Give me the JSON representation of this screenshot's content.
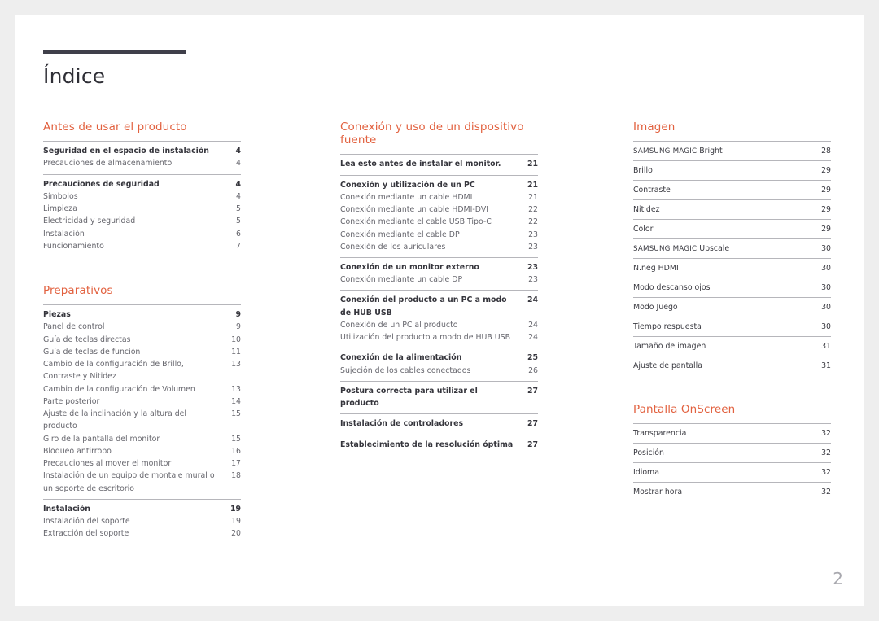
{
  "document": {
    "title": "Índice",
    "page_number": "2"
  },
  "colors": {
    "heading_accent": "#e2613f",
    "title_rule": "#3f3f4a",
    "rule": "#b6b6bb",
    "page_number": "#a8a8ae",
    "page_background": "#ffffff",
    "canvas_background": "#eeeeee"
  },
  "columns": [
    {
      "id": "left",
      "sections": [
        {
          "heading": "Antes de usar el producto",
          "groups": [
            {
              "entries": [
                {
                  "label": "Seguridad en el espacio de instalación",
                  "page": "4",
                  "level": 1
                },
                {
                  "label": "Precauciones de almacenamiento",
                  "page": "4",
                  "level": 2
                }
              ]
            },
            {
              "entries": [
                {
                  "label": "Precauciones de seguridad",
                  "page": "4",
                  "level": 1
                },
                {
                  "label": "Símbolos",
                  "page": "4",
                  "level": 2
                },
                {
                  "label": "Limpieza",
                  "page": "5",
                  "level": 2
                },
                {
                  "label": "Electricidad y seguridad",
                  "page": "5",
                  "level": 2
                },
                {
                  "label": "Instalación",
                  "page": "6",
                  "level": 2
                },
                {
                  "label": "Funcionamiento",
                  "page": "7",
                  "level": 2
                }
              ]
            }
          ]
        },
        {
          "heading": "Preparativos",
          "groups": [
            {
              "entries": [
                {
                  "label": "Piezas",
                  "page": "9",
                  "level": 1
                },
                {
                  "label": "Panel de control",
                  "page": "9",
                  "level": 2
                },
                {
                  "label": "Guía de teclas directas",
                  "page": "10",
                  "level": 2
                },
                {
                  "label": "Guía de teclas de función",
                  "page": "11",
                  "level": 2
                },
                {
                  "label": "Cambio de la configuración de Brillo, Contraste y Nitidez",
                  "page": "13",
                  "level": 2
                },
                {
                  "label": "Cambio de la configuración de Volumen",
                  "page": "13",
                  "level": 2
                },
                {
                  "label": "Parte posterior",
                  "page": "14",
                  "level": 2
                },
                {
                  "label": "Ajuste de la inclinación y la altura del producto",
                  "page": "15",
                  "level": 2
                },
                {
                  "label": "Giro de la pantalla del monitor",
                  "page": "15",
                  "level": 2
                },
                {
                  "label": "Bloqueo antirrobo",
                  "page": "16",
                  "level": 2
                },
                {
                  "label": "Precauciones al mover el monitor",
                  "page": "17",
                  "level": 2
                },
                {
                  "label": "Instalación de un equipo de montaje mural o un soporte de escritorio",
                  "page": "18",
                  "level": 2
                }
              ]
            },
            {
              "entries": [
                {
                  "label": "Instalación",
                  "page": "19",
                  "level": 1
                },
                {
                  "label": "Instalación del soporte",
                  "page": "19",
                  "level": 2
                },
                {
                  "label": "Extracción del soporte",
                  "page": "20",
                  "level": 2
                }
              ]
            }
          ]
        }
      ]
    },
    {
      "id": "middle",
      "sections": [
        {
          "heading": "Conexión y uso de un dispositivo fuente",
          "groups": [
            {
              "entries": [
                {
                  "label": "Lea esto antes de instalar el monitor.",
                  "page": "21",
                  "level": 1
                }
              ]
            },
            {
              "entries": [
                {
                  "label": "Conexión y utilización de un PC",
                  "page": "21",
                  "level": 1
                },
                {
                  "label": "Conexión mediante un cable HDMI",
                  "page": "21",
                  "level": 2
                },
                {
                  "label": "Conexión mediante un cable HDMI-DVI",
                  "page": "22",
                  "level": 2
                },
                {
                  "label": "Conexión mediante el cable USB Tipo-C",
                  "page": "22",
                  "level": 2
                },
                {
                  "label": "Conexión mediante el cable DP",
                  "page": "23",
                  "level": 2
                },
                {
                  "label": "Conexión de los auriculares",
                  "page": "23",
                  "level": 2
                }
              ]
            },
            {
              "entries": [
                {
                  "label": "Conexión de un monitor externo",
                  "page": "23",
                  "level": 1
                },
                {
                  "label": "Conexión mediante un cable DP",
                  "page": "23",
                  "level": 2
                }
              ]
            },
            {
              "entries": [
                {
                  "label": "Conexión del producto a un PC a modo de HUB USB",
                  "page": "24",
                  "level": 1
                },
                {
                  "label": "Conexión de un PC al producto",
                  "page": "24",
                  "level": 2
                },
                {
                  "label": "Utilización del producto a modo de HUB USB",
                  "page": "24",
                  "level": 2
                }
              ]
            },
            {
              "entries": [
                {
                  "label": "Conexión de la alimentación",
                  "page": "25",
                  "level": 1
                },
                {
                  "label": "Sujeción de los cables conectados",
                  "page": "26",
                  "level": 2
                }
              ]
            },
            {
              "entries": [
                {
                  "label": "Postura correcta para utilizar el producto",
                  "page": "27",
                  "level": 1
                }
              ]
            },
            {
              "entries": [
                {
                  "label": "Instalación de controladores",
                  "page": "27",
                  "level": 1
                }
              ]
            },
            {
              "entries": [
                {
                  "label": "Establecimiento de la resolución óptima",
                  "page": "27",
                  "level": 1
                }
              ]
            }
          ]
        }
      ]
    },
    {
      "id": "right",
      "sections": [
        {
          "heading": "Imagen",
          "rows": [
            {
              "label": "SAMSUNG MAGIC Bright",
              "page": "28",
              "smallcaps_prefix": "SAMSUNG MAGIC",
              "smallcaps_rest": " Bright"
            },
            {
              "label": "Brillo",
              "page": "29"
            },
            {
              "label": "Contraste",
              "page": "29"
            },
            {
              "label": "Nitidez",
              "page": "29"
            },
            {
              "label": "Color",
              "page": "29"
            },
            {
              "label": "SAMSUNG MAGIC Upscale",
              "page": "30",
              "smallcaps_prefix": "SAMSUNG MAGIC",
              "smallcaps_rest": " Upscale"
            },
            {
              "label": "N.neg HDMI",
              "page": "30"
            },
            {
              "label": "Modo descanso ojos",
              "page": "30"
            },
            {
              "label": "Modo Juego",
              "page": "30"
            },
            {
              "label": "Tiempo respuesta",
              "page": "30"
            },
            {
              "label": "Tamaño de imagen",
              "page": "31"
            },
            {
              "label": "Ajuste de pantalla",
              "page": "31"
            }
          ]
        },
        {
          "heading": "Pantalla OnScreen",
          "rows": [
            {
              "label": "Transparencia",
              "page": "32"
            },
            {
              "label": "Posición",
              "page": "32"
            },
            {
              "label": "Idioma",
              "page": "32"
            },
            {
              "label": "Mostrar hora",
              "page": "32"
            }
          ]
        }
      ]
    }
  ]
}
